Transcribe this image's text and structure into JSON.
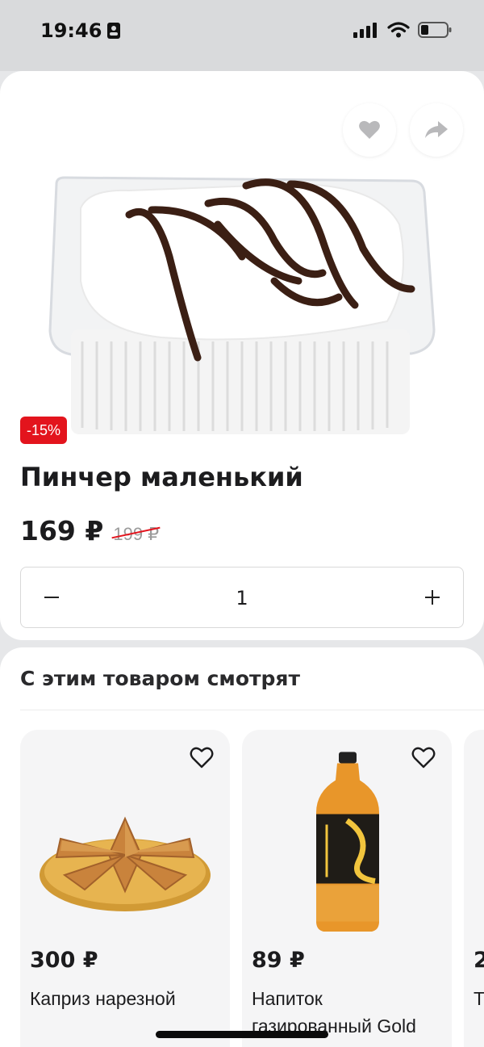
{
  "status_bar": {
    "time": "19:46"
  },
  "product": {
    "title": "Пинчер маленький",
    "discount_badge": "-15%",
    "price": "169 ₽",
    "old_price": "199 ₽",
    "quantity": "1",
    "image_icon": "cake-image"
  },
  "related": {
    "title": "С этим товаром смотрят",
    "items": [
      {
        "price": "300 ₽",
        "name": "Каприз нарезной",
        "image_icon": "layered-cake-image"
      },
      {
        "price": "89 ₽",
        "name": "Напиток газированный Gold",
        "image_icon": "soda-bottle-image"
      },
      {
        "price": "2",
        "name": "Т",
        "image_icon": "product-image"
      }
    ]
  },
  "colors": {
    "accent_red": "#e3141d",
    "card_background": "#ffffff",
    "page_background": "#e6e7e9"
  }
}
